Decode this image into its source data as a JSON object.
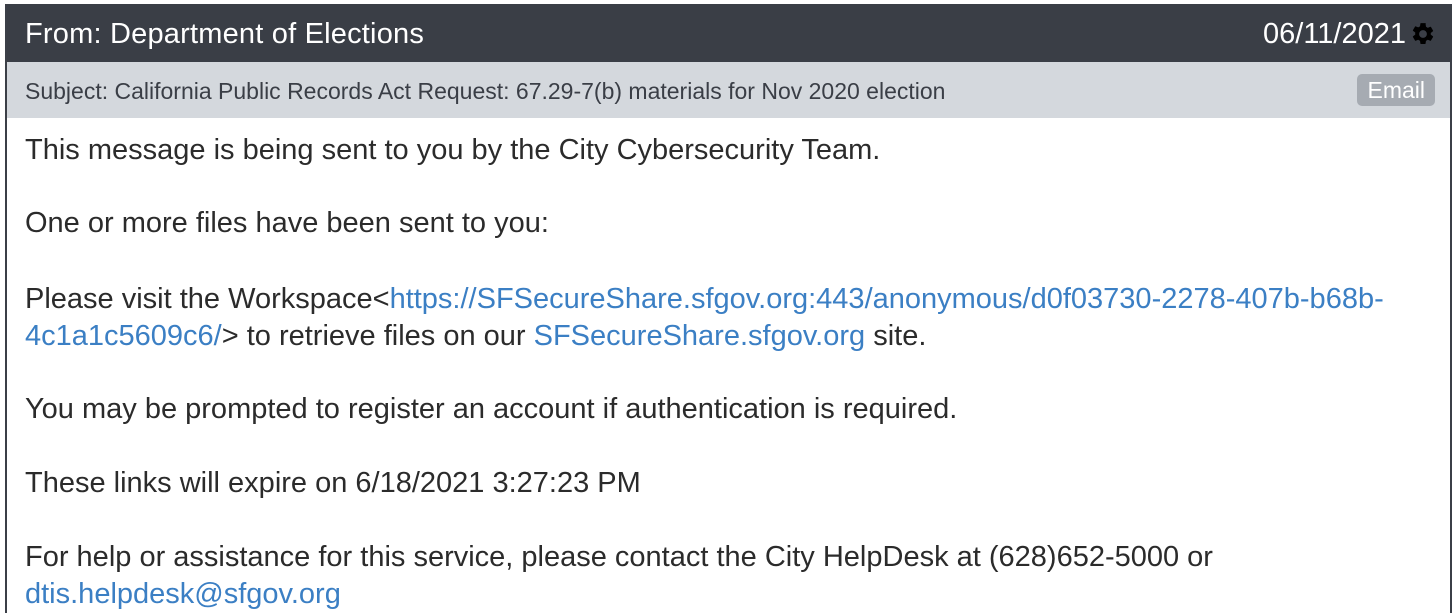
{
  "header": {
    "from": "From: Department of Elections",
    "date": "06/11/2021",
    "settings_icon": "gear-icon"
  },
  "subject_bar": {
    "subject": "Subject: California Public Records Act Request: 67.29-7(b) materials for Nov 2020 election",
    "badge": "Email"
  },
  "body": {
    "line1": "This message is being sent to you by the City Cybersecurity Team.",
    "line2": "One or more files have been sent to you:",
    "line3_prefix": "Please visit the Workspace<",
    "line3_link": "https://SFSecureShare.sfgov.org:443/anonymous/d0f03730-2278-407b-b68b-4c1a1c5609c6/",
    "line3_middle": "> to retrieve files on our ",
    "line3_site_link": "SFSecureShare.sfgov.org",
    "line3_suffix": " site.",
    "line4": "You may be prompted to register an account if authentication is required.",
    "line5": "These links will expire on 6/18/2021 3:27:23 PM",
    "line6_prefix": "For help or assistance for this service, please contact the City HelpDesk at (628)652-5000 or ",
    "line6_email": "dtis.helpdesk@sfgov.org"
  },
  "colors": {
    "header_bg": "#3a3e46",
    "subject_bg": "#d4d8dd",
    "link": "#3b7fc4",
    "badge_bg": "#a6abb2"
  }
}
